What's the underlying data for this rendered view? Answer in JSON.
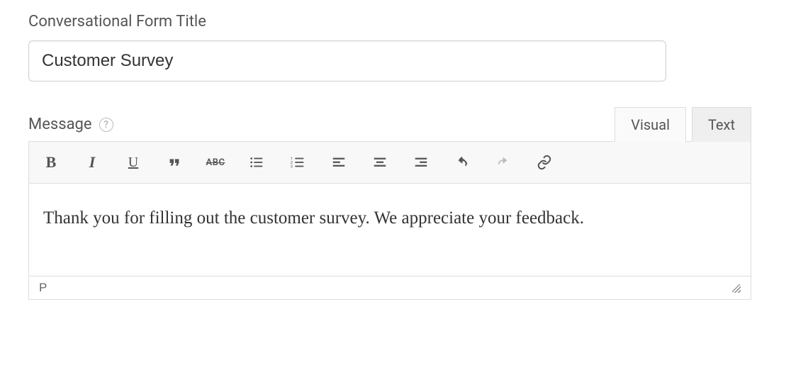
{
  "form_title": {
    "label": "Conversational Form Title",
    "value": "Customer Survey"
  },
  "message": {
    "label": "Message",
    "tabs": {
      "visual": "Visual",
      "text": "Text",
      "active": "visual"
    },
    "toolbar": {
      "bold": "B",
      "italic": "I",
      "underline": "U",
      "strikethrough": "ABC"
    },
    "content": "Thank you for filling out the customer survey. We appreciate your feedback.",
    "status_path": "P"
  }
}
